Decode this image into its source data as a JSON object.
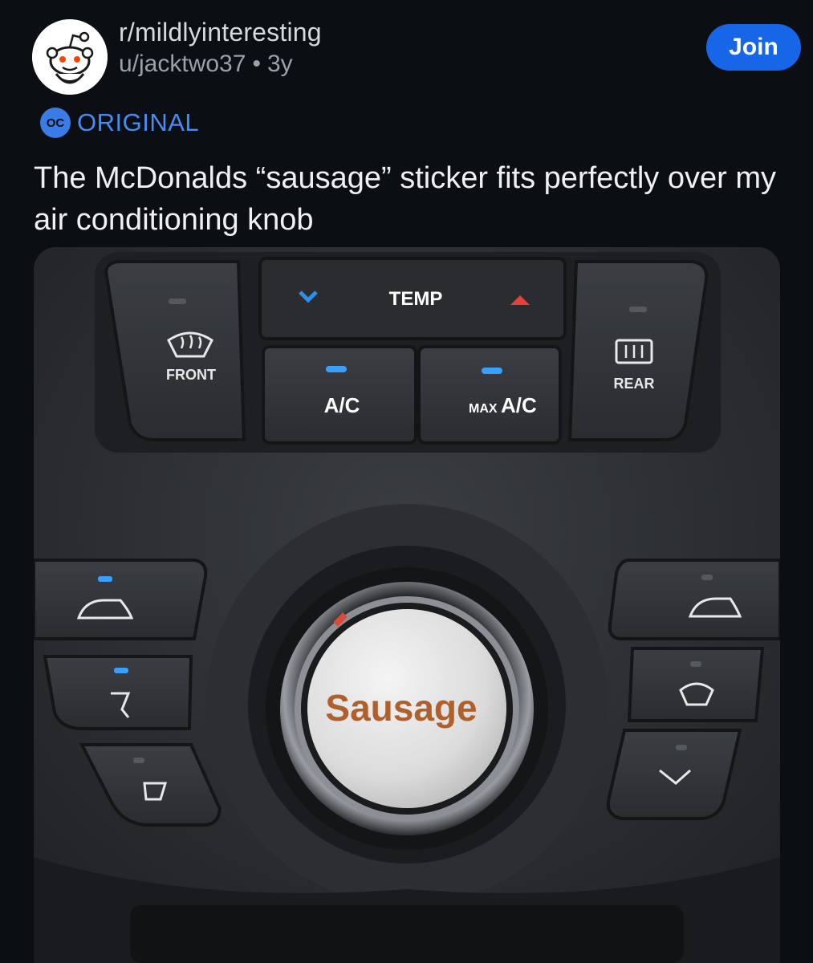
{
  "post": {
    "subreddit": "r/mildlyinteresting",
    "author": "u/jacktwo37",
    "separator": "•",
    "age": "3y",
    "join_label": "Join",
    "flair_badge": "OC",
    "flair_text": "ORIGINAL",
    "title": "The McDonalds “sausage” sticker fits perfectly over my air conditioning knob"
  },
  "photo": {
    "front_label": "FRONT",
    "temp_label": "TEMP",
    "rear_label": "REAR",
    "ac_label": "A/C",
    "max_label": "MAX",
    "max_ac_label": "A/C",
    "sticker_text": "Sausage"
  },
  "colors": {
    "accent": "#1766e8",
    "flair": "#4a8bf0",
    "indicator": "#3aa0ff",
    "sticker_text": "#b0602c"
  }
}
